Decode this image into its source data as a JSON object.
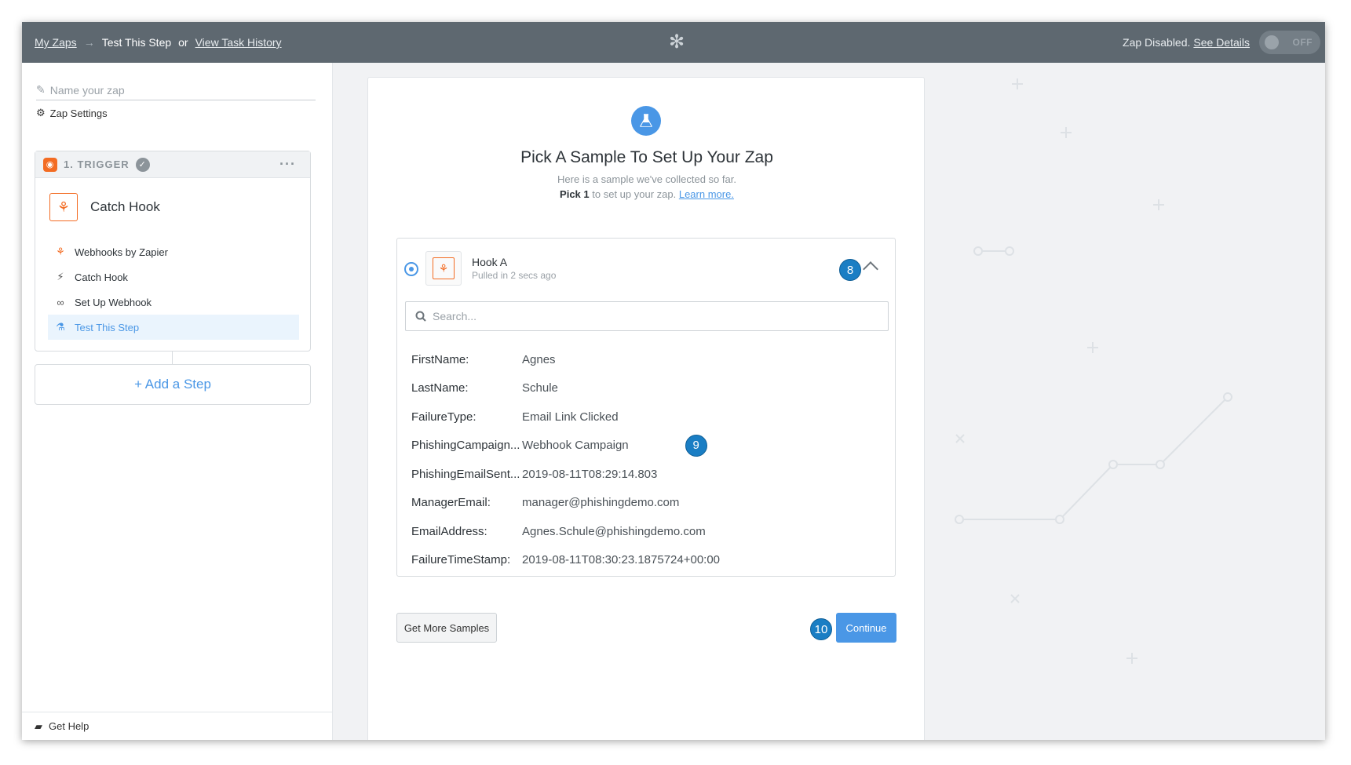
{
  "topbar": {
    "my_zaps": "My Zaps",
    "arrow": "→",
    "current": "Test This Step",
    "or": "or",
    "task_history": "View Task History",
    "status": "Zap Disabled.",
    "see_details": "See Details",
    "toggle_label": "OFF"
  },
  "sidebar": {
    "name_placeholder": "Name your zap",
    "settings": "Zap Settings",
    "trigger_label": "1. TRIGGER",
    "app_name": "Catch Hook",
    "steps": [
      {
        "label": "Webhooks by Zapier",
        "icon": "webhook-icon"
      },
      {
        "label": "Catch Hook",
        "icon": "bolt-icon"
      },
      {
        "label": "Set Up Webhook",
        "icon": "link-icon"
      },
      {
        "label": "Test This Step",
        "icon": "flask-icon"
      }
    ],
    "add_step": "+ Add a Step",
    "get_help": "Get Help"
  },
  "main": {
    "title": "Pick A Sample To Set Up Your Zap",
    "subtitle": "Here is a sample we've collected so far.",
    "pick_bold": "Pick 1",
    "pick_rest": "to set up your zap.",
    "learn_more": "Learn more.",
    "sample": {
      "name": "Hook A",
      "pulled": "Pulled in 2 secs ago",
      "search_placeholder": "Search...",
      "fields": [
        {
          "key": "FirstName:",
          "value": "Agnes"
        },
        {
          "key": "LastName:",
          "value": "Schule"
        },
        {
          "key": "FailureType:",
          "value": "Email Link Clicked"
        },
        {
          "key": "PhishingCampaign...",
          "value": "Webhook Campaign"
        },
        {
          "key": "PhishingEmailSent...",
          "value": "2019-08-11T08:29:14.803"
        },
        {
          "key": "ManagerEmail:",
          "value": "manager@phishingdemo.com"
        },
        {
          "key": "EmailAddress:",
          "value": "Agnes.Schule@phishingdemo.com"
        },
        {
          "key": "FailureTimeStamp:",
          "value": "2019-08-11T08:30:23.1875724+00:00"
        }
      ]
    },
    "get_more": "Get More Samples",
    "continue": "Continue",
    "badges": {
      "b8": "8",
      "b9": "9",
      "b10": "10"
    }
  },
  "colors": {
    "accent": "#4a97e6",
    "brand": "#f36c23",
    "topbar": "#5e6870",
    "badge": "#1a7ec4"
  }
}
